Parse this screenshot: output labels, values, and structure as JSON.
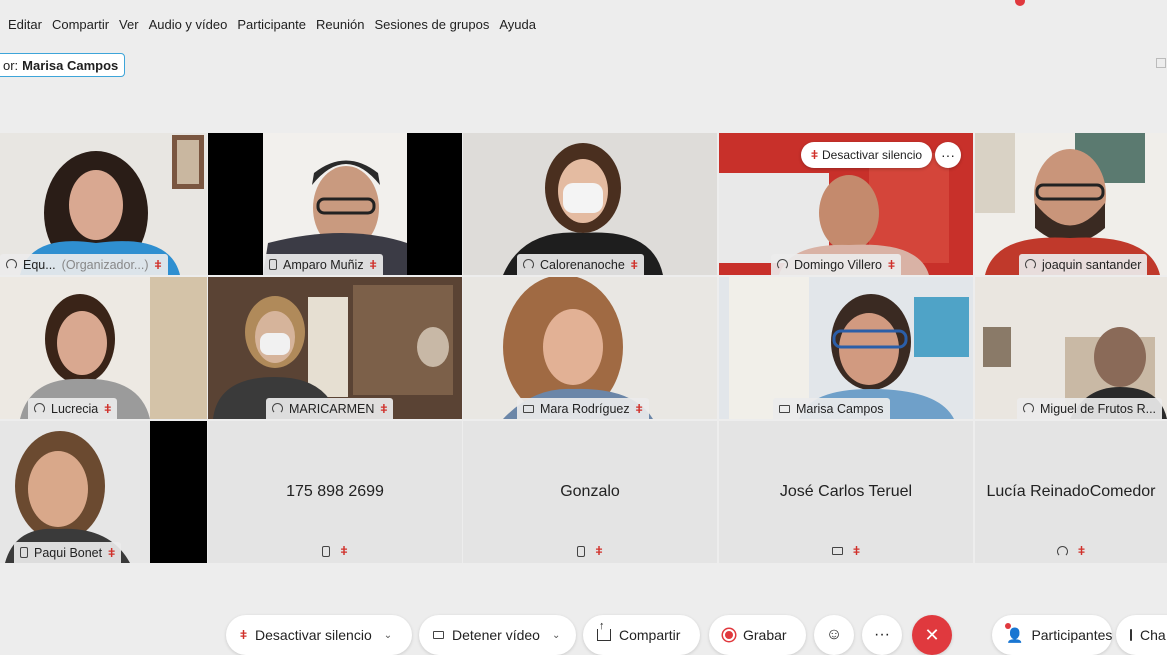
{
  "menu": [
    "Editar",
    "Compartir",
    "Ver",
    "Audio y vídeo",
    "Participante",
    "Reunión",
    "Sesiones de grupos",
    "Ayuda"
  ],
  "speaker": {
    "prefix": "or:",
    "name": "Marisa Campos"
  },
  "tiles": [
    {
      "name": "Equ...",
      "sub": "(Organizador...)",
      "icon": "headset-icon",
      "muted": true
    },
    {
      "name": "Amparo Muñiz",
      "icon": "phone-icon",
      "muted": true
    },
    {
      "name": "Calorenanoche",
      "icon": "headset-icon",
      "muted": true
    },
    {
      "name": "Domingo Villero",
      "icon": "headset-icon",
      "muted": true
    },
    {
      "name": "joaquin santander",
      "icon": "headset-icon",
      "muted": false
    },
    {
      "name": "Lucrecia",
      "icon": "headset-icon",
      "muted": true
    },
    {
      "name": "MARICARMEN",
      "icon": "headset-icon",
      "muted": true
    },
    {
      "name": "Mara Rodríguez",
      "icon": "camera-icon",
      "muted": true
    },
    {
      "name": "Marisa Campos",
      "icon": "camera-icon",
      "muted": false,
      "active": true
    },
    {
      "name": "Miguel de Frutos R...",
      "icon": "headset-icon",
      "muted": false
    },
    {
      "name": "Paqui Bonet",
      "icon": "phone-icon",
      "muted": true
    },
    {
      "name": "175 898 2699",
      "icon": "phone-icon",
      "muted": true
    },
    {
      "name": "Gonzalo",
      "icon": "phone-icon",
      "muted": true
    },
    {
      "name": "José Carlos Teruel",
      "icon": "camera-icon",
      "muted": true
    },
    {
      "name": "Lucía ReinadoComedor",
      "icon": "headset-icon",
      "muted": true
    }
  ],
  "overlay": {
    "unmute_label": "Desactivar silencio",
    "more_label": "···"
  },
  "toolbar": {
    "unmute": "Desactivar silencio",
    "stop_video": "Detener vídeo",
    "share": "Compartir",
    "record": "Grabar",
    "more": "···",
    "leave": "✕",
    "participants": "Participantes",
    "chat": "Cha"
  },
  "colors": {
    "accent": "#3aa7de",
    "danger": "#e0393e",
    "background": "#ededed"
  }
}
